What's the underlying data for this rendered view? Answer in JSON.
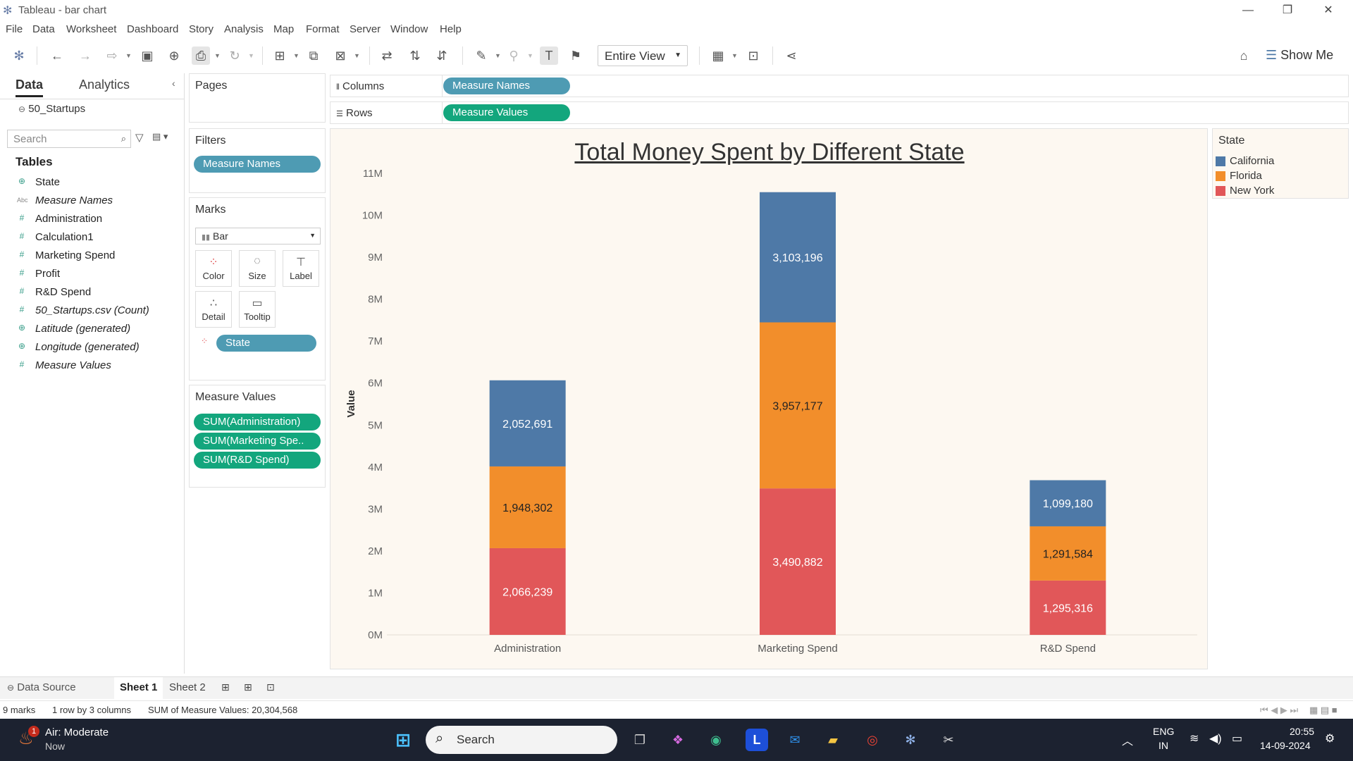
{
  "window": {
    "title": "Tableau - bar chart",
    "minimize": "—",
    "maximize": "❐",
    "close": "✕"
  },
  "menu": [
    "File",
    "Data",
    "Worksheet",
    "Dashboard",
    "Story",
    "Analysis",
    "Map",
    "Format",
    "Server",
    "Window",
    "Help"
  ],
  "toolbar": {
    "fit_option": "Entire View",
    "show_me_label": "Show Me"
  },
  "data_pane": {
    "tabs": [
      "Data",
      "Analytics"
    ],
    "datasource": "50_Startups",
    "search_placeholder": "Search",
    "tables_header": "Tables",
    "fields": [
      {
        "name": "State",
        "type": "globe",
        "italic": false
      },
      {
        "name": "Measure Names",
        "type": "abc",
        "italic": true
      },
      {
        "name": "Administration",
        "type": "measure",
        "italic": false
      },
      {
        "name": "Calculation1",
        "type": "measure",
        "italic": false
      },
      {
        "name": "Marketing Spend",
        "type": "measure",
        "italic": false
      },
      {
        "name": "Profit",
        "type": "measure",
        "italic": false
      },
      {
        "name": "R&D Spend",
        "type": "measure",
        "italic": false
      },
      {
        "name": "50_Startups.csv (Count)",
        "type": "measure",
        "italic": true
      },
      {
        "name": "Latitude (generated)",
        "type": "globe",
        "italic": true
      },
      {
        "name": "Longitude (generated)",
        "type": "globe",
        "italic": true
      },
      {
        "name": "Measure Values",
        "type": "measure",
        "italic": true
      }
    ]
  },
  "cards": {
    "pages": "Pages",
    "filters": {
      "title": "Filters",
      "pills": [
        "Measure Names"
      ]
    },
    "marks": {
      "title": "Marks",
      "mark_type": "Bar",
      "buttons": [
        "Color",
        "Size",
        "Label",
        "Detail",
        "Tooltip"
      ],
      "pill": "State"
    },
    "measure_values": {
      "title": "Measure Values",
      "pills": [
        "SUM(Administration)",
        "SUM(Marketing Spe..",
        "SUM(R&D Spend)"
      ]
    }
  },
  "shelves": {
    "columns": {
      "label": "Columns",
      "pill": "Measure Names"
    },
    "rows": {
      "label": "Rows",
      "pill": "Measure Values"
    }
  },
  "chart_data": {
    "type": "bar",
    "stacked": true,
    "title": "Total Money Spent by Different State",
    "xlabel": "",
    "ylabel": "Value",
    "categories": [
      "Administration",
      "Marketing Spend",
      "R&D Spend"
    ],
    "series": [
      {
        "name": "New York",
        "color": "#e15759",
        "values": [
          2066239,
          3490882,
          1295316
        ],
        "label_color": "#ffffff"
      },
      {
        "name": "Florida",
        "color": "#f28e2b",
        "values": [
          1948302,
          3957177,
          1291584
        ],
        "label_color": "#222222"
      },
      {
        "name": "California",
        "color": "#4e79a7",
        "values": [
          2052691,
          3103196,
          1099180
        ],
        "label_color": "#ffffff"
      }
    ],
    "ylim": [
      0,
      11000000
    ],
    "yticks": [
      "0M",
      "1M",
      "2M",
      "3M",
      "4M",
      "5M",
      "6M",
      "7M",
      "8M",
      "9M",
      "10M",
      "11M"
    ],
    "grid": false,
    "legend": "right"
  },
  "legend": {
    "title": "State",
    "items": [
      {
        "name": "California",
        "color": "#4e79a7"
      },
      {
        "name": "Florida",
        "color": "#f28e2b"
      },
      {
        "name": "New York",
        "color": "#e15759"
      }
    ]
  },
  "sheet_tabs": {
    "data_source": "Data Source",
    "sheets": [
      "Sheet 1",
      "Sheet 2"
    ],
    "active": "Sheet 1"
  },
  "status": {
    "marks": "9 marks",
    "dims": "1 row by 3 columns",
    "sum": "SUM of Measure Values: 20,304,568"
  },
  "taskbar": {
    "weather_title": "Air: Moderate",
    "weather_sub": "Now",
    "weather_badge": "1",
    "search": "Search",
    "lang": "ENG",
    "region": "IN",
    "time": "20:55",
    "date": "14-09-2024",
    "app_letter": "L"
  }
}
